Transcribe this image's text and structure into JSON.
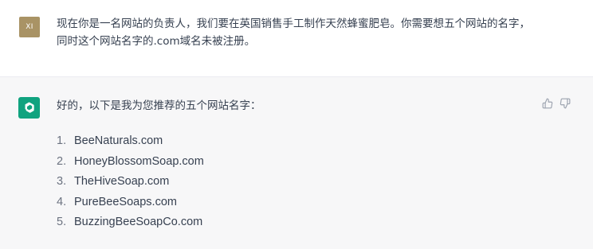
{
  "user_message": {
    "avatar_initials": "XI",
    "text": "现在你是一名网站的负责人，我们要在英国销售手工制作天然蜂蜜肥皂。你需要想五个网站的名字，同时这个网站名字的.com域名未被注册。"
  },
  "assistant_message": {
    "avatar_icon": "openai-logo-icon",
    "intro": "好的，以下是我为您推荐的五个网站名字：",
    "items": [
      {
        "num": "1.",
        "name": "BeeNaturals.com"
      },
      {
        "num": "2.",
        "name": "HoneyBlossomSoap.com"
      },
      {
        "num": "3.",
        "name": "TheHiveSoap.com"
      },
      {
        "num": "4.",
        "name": "PureBeeSoaps.com"
      },
      {
        "num": "5.",
        "name": "BuzzingBeeSoapCo.com"
      }
    ],
    "feedback_icons": [
      "thumbs-up-icon",
      "thumbs-down-icon"
    ]
  },
  "colors": {
    "user_avatar": "#a99365",
    "bot_avatar": "#10a37f",
    "assistant_bg": "#f7f7f8",
    "text": "#374151"
  }
}
